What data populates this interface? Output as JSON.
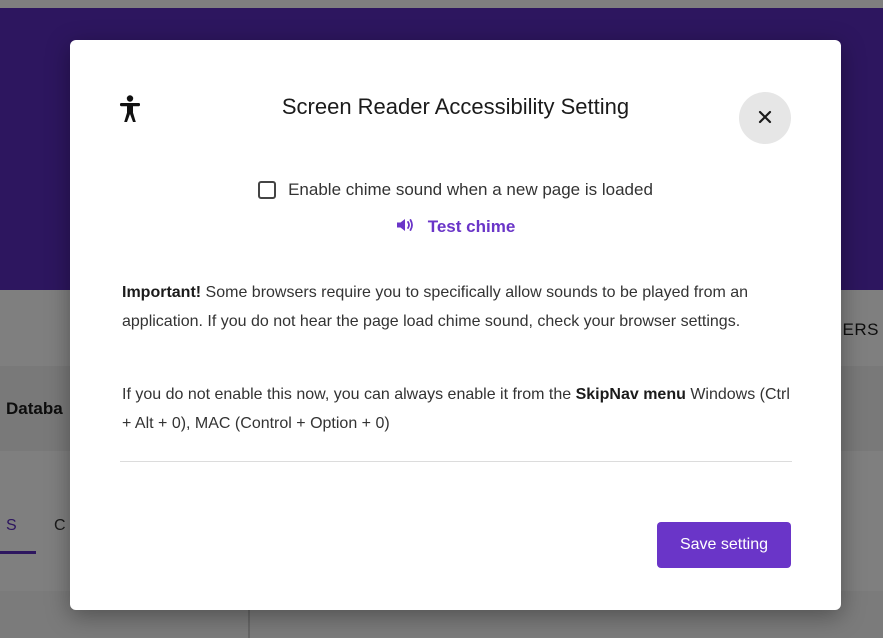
{
  "background": {
    "tab_partial_text": "ERS",
    "section_partial_text": "Databa",
    "tab1_partial": "S",
    "tab2_partial": "C"
  },
  "modal": {
    "title": "Screen Reader Accessibility Setting",
    "accessibility_icon": "accessibility-person-icon",
    "close_icon": "close-icon",
    "close_symbol": "×",
    "chime_checkbox": {
      "checked": false,
      "label": "Enable chime sound when a new page is loaded"
    },
    "test_chime_label": "Test chime",
    "test_chime_icon": "speaker-icon",
    "important_bold": "Important!",
    "important_text": " Some browsers require you to specifically allow sounds to be played from an application. If you do not hear the page load chime sound, check your browser settings.",
    "enable_text_before": "If you do not enable this now, you can always enable it from the ",
    "skipnav_bold": "SkipNav menu",
    "enable_text_after": " Windows (Ctrl + Alt + 0), MAC (Control + Option + 0)",
    "save_button_label": "Save setting"
  },
  "colors": {
    "brand_purple": "#5a2cbe",
    "accent_purple": "#6a35c8",
    "close_bg": "#e6e6e6"
  }
}
